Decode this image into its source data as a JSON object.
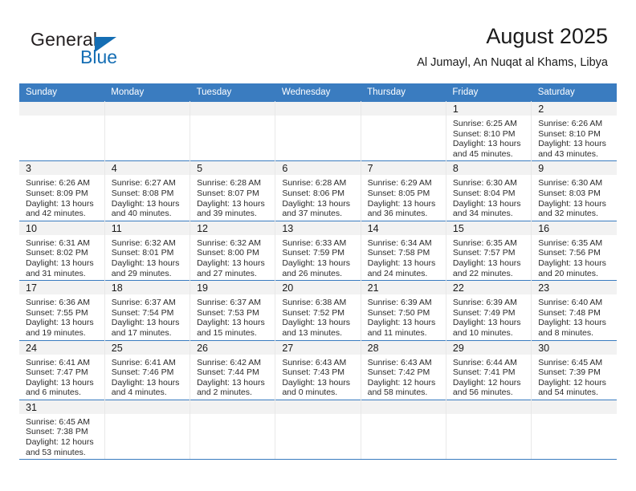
{
  "brand": {
    "name_top": "General",
    "name_bottom": "Blue",
    "accent_color": "#156eb4"
  },
  "header": {
    "title": "August 2025",
    "subtitle": "Al Jumayl, An Nuqat al Khams, Libya"
  },
  "calendar": {
    "header_background": "#3a7cc0",
    "daynum_background": "#f2f2f2",
    "weekday_headers": [
      "Sunday",
      "Monday",
      "Tuesday",
      "Wednesday",
      "Thursday",
      "Friday",
      "Saturday"
    ],
    "weeks": [
      [
        {
          "day": "",
          "lines": []
        },
        {
          "day": "",
          "lines": []
        },
        {
          "day": "",
          "lines": []
        },
        {
          "day": "",
          "lines": []
        },
        {
          "day": "",
          "lines": []
        },
        {
          "day": "1",
          "lines": [
            "Sunrise: 6:25 AM",
            "Sunset: 8:10 PM",
            "Daylight: 13 hours",
            "and 45 minutes."
          ]
        },
        {
          "day": "2",
          "lines": [
            "Sunrise: 6:26 AM",
            "Sunset: 8:10 PM",
            "Daylight: 13 hours",
            "and 43 minutes."
          ]
        }
      ],
      [
        {
          "day": "3",
          "lines": [
            "Sunrise: 6:26 AM",
            "Sunset: 8:09 PM",
            "Daylight: 13 hours",
            "and 42 minutes."
          ]
        },
        {
          "day": "4",
          "lines": [
            "Sunrise: 6:27 AM",
            "Sunset: 8:08 PM",
            "Daylight: 13 hours",
            "and 40 minutes."
          ]
        },
        {
          "day": "5",
          "lines": [
            "Sunrise: 6:28 AM",
            "Sunset: 8:07 PM",
            "Daylight: 13 hours",
            "and 39 minutes."
          ]
        },
        {
          "day": "6",
          "lines": [
            "Sunrise: 6:28 AM",
            "Sunset: 8:06 PM",
            "Daylight: 13 hours",
            "and 37 minutes."
          ]
        },
        {
          "day": "7",
          "lines": [
            "Sunrise: 6:29 AM",
            "Sunset: 8:05 PM",
            "Daylight: 13 hours",
            "and 36 minutes."
          ]
        },
        {
          "day": "8",
          "lines": [
            "Sunrise: 6:30 AM",
            "Sunset: 8:04 PM",
            "Daylight: 13 hours",
            "and 34 minutes."
          ]
        },
        {
          "day": "9",
          "lines": [
            "Sunrise: 6:30 AM",
            "Sunset: 8:03 PM",
            "Daylight: 13 hours",
            "and 32 minutes."
          ]
        }
      ],
      [
        {
          "day": "10",
          "lines": [
            "Sunrise: 6:31 AM",
            "Sunset: 8:02 PM",
            "Daylight: 13 hours",
            "and 31 minutes."
          ]
        },
        {
          "day": "11",
          "lines": [
            "Sunrise: 6:32 AM",
            "Sunset: 8:01 PM",
            "Daylight: 13 hours",
            "and 29 minutes."
          ]
        },
        {
          "day": "12",
          "lines": [
            "Sunrise: 6:32 AM",
            "Sunset: 8:00 PM",
            "Daylight: 13 hours",
            "and 27 minutes."
          ]
        },
        {
          "day": "13",
          "lines": [
            "Sunrise: 6:33 AM",
            "Sunset: 7:59 PM",
            "Daylight: 13 hours",
            "and 26 minutes."
          ]
        },
        {
          "day": "14",
          "lines": [
            "Sunrise: 6:34 AM",
            "Sunset: 7:58 PM",
            "Daylight: 13 hours",
            "and 24 minutes."
          ]
        },
        {
          "day": "15",
          "lines": [
            "Sunrise: 6:35 AM",
            "Sunset: 7:57 PM",
            "Daylight: 13 hours",
            "and 22 minutes."
          ]
        },
        {
          "day": "16",
          "lines": [
            "Sunrise: 6:35 AM",
            "Sunset: 7:56 PM",
            "Daylight: 13 hours",
            "and 20 minutes."
          ]
        }
      ],
      [
        {
          "day": "17",
          "lines": [
            "Sunrise: 6:36 AM",
            "Sunset: 7:55 PM",
            "Daylight: 13 hours",
            "and 19 minutes."
          ]
        },
        {
          "day": "18",
          "lines": [
            "Sunrise: 6:37 AM",
            "Sunset: 7:54 PM",
            "Daylight: 13 hours",
            "and 17 minutes."
          ]
        },
        {
          "day": "19",
          "lines": [
            "Sunrise: 6:37 AM",
            "Sunset: 7:53 PM",
            "Daylight: 13 hours",
            "and 15 minutes."
          ]
        },
        {
          "day": "20",
          "lines": [
            "Sunrise: 6:38 AM",
            "Sunset: 7:52 PM",
            "Daylight: 13 hours",
            "and 13 minutes."
          ]
        },
        {
          "day": "21",
          "lines": [
            "Sunrise: 6:39 AM",
            "Sunset: 7:50 PM",
            "Daylight: 13 hours",
            "and 11 minutes."
          ]
        },
        {
          "day": "22",
          "lines": [
            "Sunrise: 6:39 AM",
            "Sunset: 7:49 PM",
            "Daylight: 13 hours",
            "and 10 minutes."
          ]
        },
        {
          "day": "23",
          "lines": [
            "Sunrise: 6:40 AM",
            "Sunset: 7:48 PM",
            "Daylight: 13 hours",
            "and 8 minutes."
          ]
        }
      ],
      [
        {
          "day": "24",
          "lines": [
            "Sunrise: 6:41 AM",
            "Sunset: 7:47 PM",
            "Daylight: 13 hours",
            "and 6 minutes."
          ]
        },
        {
          "day": "25",
          "lines": [
            "Sunrise: 6:41 AM",
            "Sunset: 7:46 PM",
            "Daylight: 13 hours",
            "and 4 minutes."
          ]
        },
        {
          "day": "26",
          "lines": [
            "Sunrise: 6:42 AM",
            "Sunset: 7:44 PM",
            "Daylight: 13 hours",
            "and 2 minutes."
          ]
        },
        {
          "day": "27",
          "lines": [
            "Sunrise: 6:43 AM",
            "Sunset: 7:43 PM",
            "Daylight: 13 hours",
            "and 0 minutes."
          ]
        },
        {
          "day": "28",
          "lines": [
            "Sunrise: 6:43 AM",
            "Sunset: 7:42 PM",
            "Daylight: 12 hours",
            "and 58 minutes."
          ]
        },
        {
          "day": "29",
          "lines": [
            "Sunrise: 6:44 AM",
            "Sunset: 7:41 PM",
            "Daylight: 12 hours",
            "and 56 minutes."
          ]
        },
        {
          "day": "30",
          "lines": [
            "Sunrise: 6:45 AM",
            "Sunset: 7:39 PM",
            "Daylight: 12 hours",
            "and 54 minutes."
          ]
        }
      ],
      [
        {
          "day": "31",
          "lines": [
            "Sunrise: 6:45 AM",
            "Sunset: 7:38 PM",
            "Daylight: 12 hours",
            "and 53 minutes."
          ]
        },
        {
          "day": "",
          "lines": []
        },
        {
          "day": "",
          "lines": []
        },
        {
          "day": "",
          "lines": []
        },
        {
          "day": "",
          "lines": []
        },
        {
          "day": "",
          "lines": []
        },
        {
          "day": "",
          "lines": []
        }
      ]
    ]
  }
}
